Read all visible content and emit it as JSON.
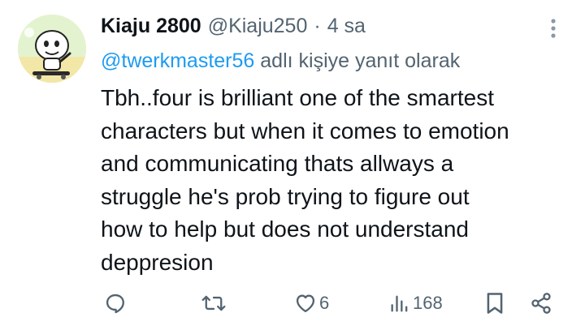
{
  "tweet": {
    "display_name": "Kiaju 2800",
    "handle": "@Kiaju250",
    "separator": "·",
    "time": "4 sa",
    "reply_to": {
      "mention": "@twerkmaster56",
      "suffix": "adlı kişiye yanıt olarak"
    },
    "text_lines": [
      "Tbh..four is brilliant one of the smartest",
      "characters but when it comes to emotion",
      "and communicating thats allways a",
      "struggle he's prob trying to figure out",
      "how to help but does not understand",
      "deppresion"
    ],
    "actions": {
      "reply": {
        "icon": "reply-icon",
        "count": ""
      },
      "retweet": {
        "icon": "retweet-icon",
        "count": ""
      },
      "like": {
        "icon": "heart-icon",
        "count": "6"
      },
      "views": {
        "icon": "views-icon",
        "count": "168"
      },
      "bookmark": {
        "icon": "bookmark-icon"
      },
      "share": {
        "icon": "share-icon"
      }
    },
    "more_icon": "more-vertical-icon"
  },
  "colors": {
    "text": "#0f1419",
    "secondary": "#536471",
    "accent": "#1d9bf0",
    "background": "#ffffff"
  }
}
